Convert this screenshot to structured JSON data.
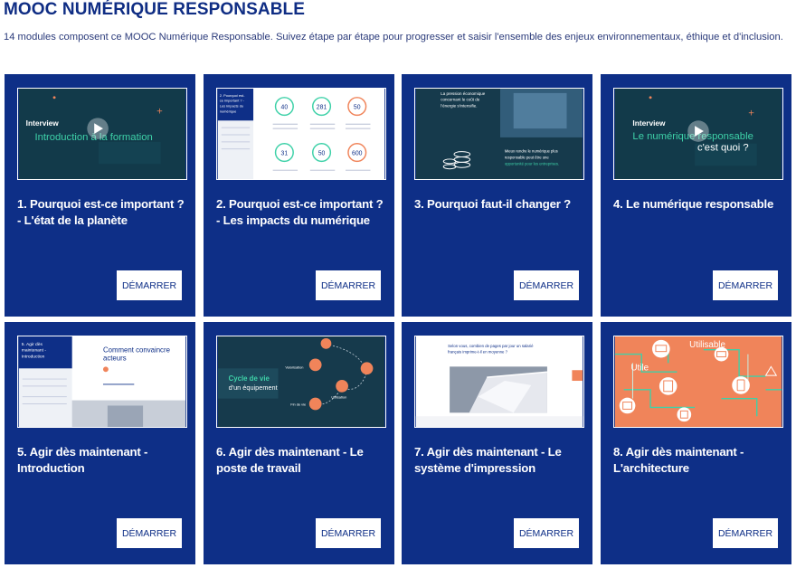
{
  "header": {
    "title": "MOOC NUMÉRIQUE RESPONSABLE",
    "subtitle": "14 modules composent ce MOOC Numérique Responsable. Suivez étape par étape pour progresser et saisir l'ensemble des enjeux environnementaux, éthique et d'inclusion."
  },
  "colors": {
    "card_bg": "#0e2f87",
    "title": "#0f2d84",
    "accent_orange": "#f0845a",
    "accent_teal": "#3ed1a8"
  },
  "cards": [
    {
      "title": "1. Pourquoi est-ce important ? - L'état de la planète",
      "button": "DÉMARRER",
      "thumb": {
        "t1": "Interview",
        "t2": "Introduction à la formation"
      }
    },
    {
      "title": "2. Pourquoi est-ce important ? - Les impacts du numérique",
      "button": "DÉMARRER",
      "thumb": {
        "t1": "2. Pourquoi est-ce important ? - Les impacts du numérique",
        "n1": "40",
        "n2": "281",
        "n3": "50",
        "n4": "31",
        "n5": "50",
        "n6": "600"
      }
    },
    {
      "title": "3. Pourquoi faut-il changer ?",
      "button": "DÉMARRER",
      "thumb": {
        "t1": "La pression économique concernant le coût de l'énergie s'intensifie.",
        "t2": "Mieux rendre le numérique plus responsable peut être une opportunité pour les entreprises."
      }
    },
    {
      "title": "4. Le numérique responsable",
      "button": "DÉMARRER",
      "thumb": {
        "t1": "Interview",
        "t2": "Le numérique responsable",
        "t3": "c'est quoi ?"
      }
    },
    {
      "title": "5. Agir dès maintenant - Introduction",
      "button": "DÉMARRER",
      "thumb": {
        "t1": "5. Agir dès maintenant - Introduction",
        "t2": "Comment convaincre les acteurs"
      }
    },
    {
      "title": "6. Agir dès maintenant - Le poste de travail",
      "button": "DÉMARRER",
      "thumb": {
        "t1": "Cycle de vie",
        "t2": "d'un équipement",
        "t3": "Valorisation",
        "t4": "Utilisation",
        "t5": "Fin de vie"
      }
    },
    {
      "title": "7. Agir dès maintenant - Le système d'impression",
      "button": "DÉMARRER",
      "thumb": {
        "t1": "Selon vous, combien de pages par jour un salarié français imprime-t-il en moyenne ?"
      }
    },
    {
      "title": "8. Agir dès maintenant - L'architecture",
      "button": "DÉMARRER",
      "thumb": {
        "t1": "Utilisable",
        "t2": "Utile"
      }
    }
  ]
}
